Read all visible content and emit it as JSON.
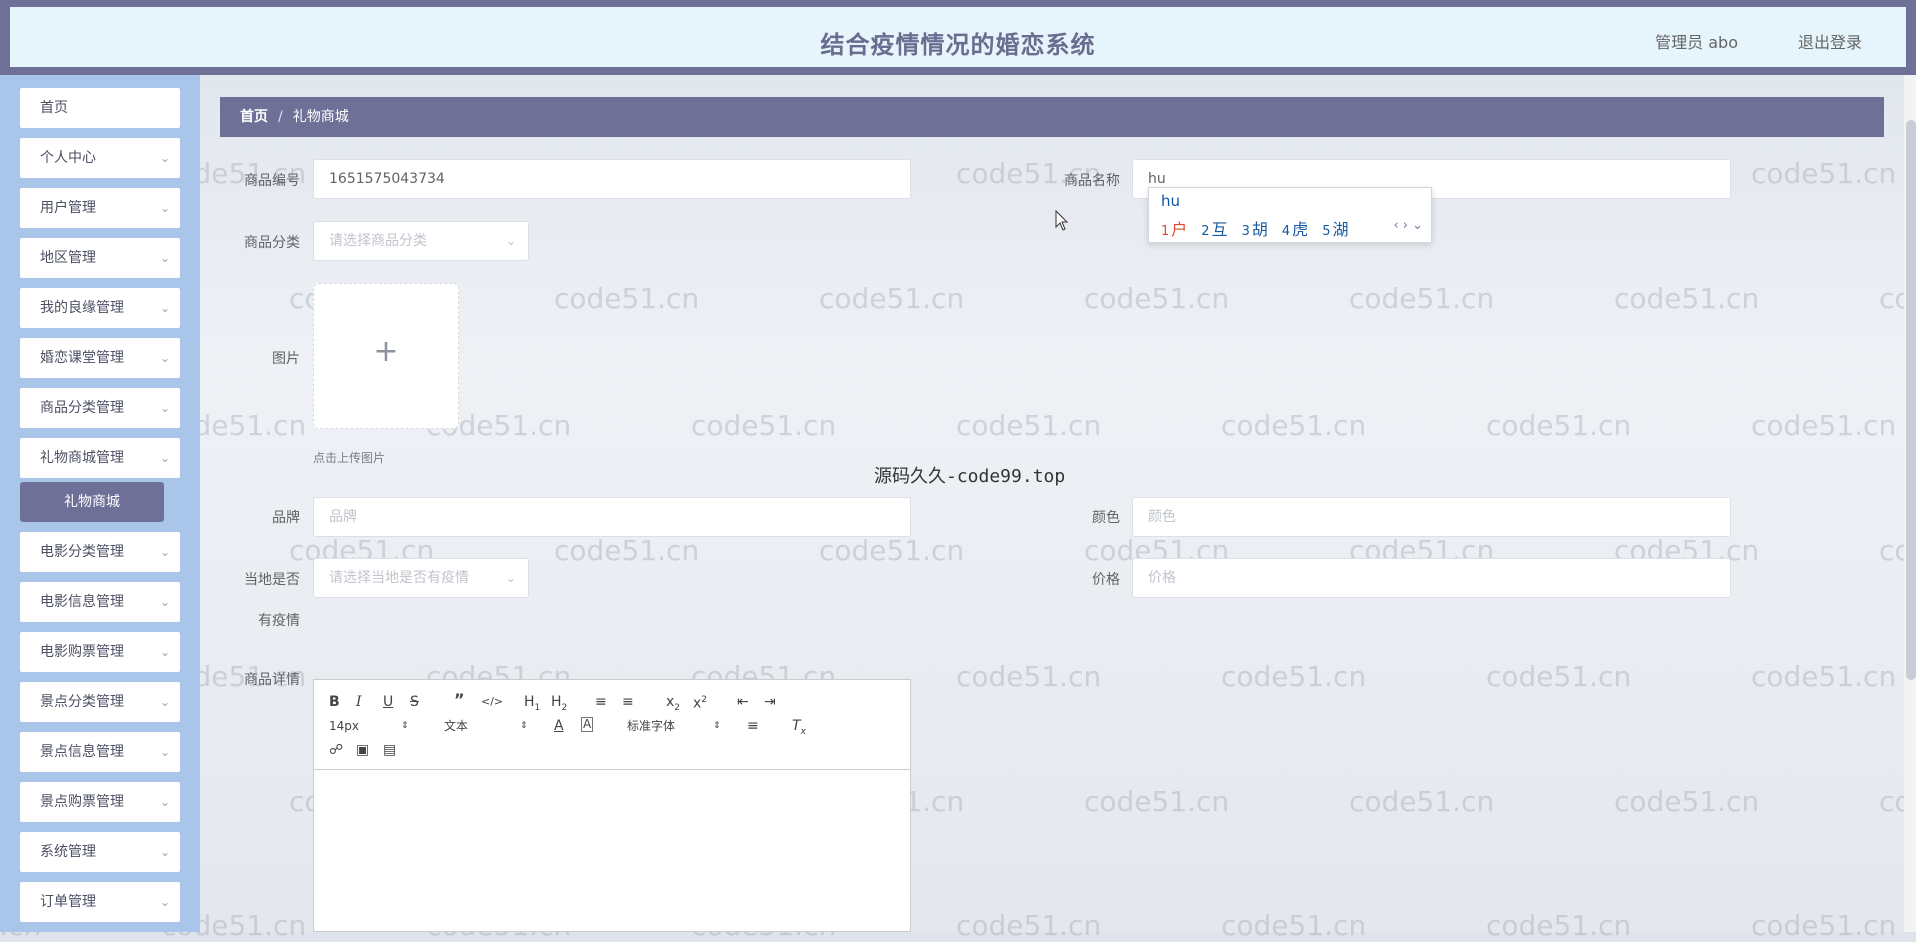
{
  "header": {
    "title": "结合疫情情况的婚恋系统",
    "user": "管理员 abo",
    "logout": "退出登录"
  },
  "sidebar": {
    "items": [
      {
        "label": "首页",
        "has_arrow": false
      },
      {
        "label": "个人中心",
        "has_arrow": true
      },
      {
        "label": "用户管理",
        "has_arrow": true
      },
      {
        "label": "地区管理",
        "has_arrow": true
      },
      {
        "label": "我的良缘管理",
        "has_arrow": true
      },
      {
        "label": "婚恋课堂管理",
        "has_arrow": true
      },
      {
        "label": "商品分类管理",
        "has_arrow": true
      },
      {
        "label": "礼物商城管理",
        "has_arrow": true
      },
      {
        "label": "电影分类管理",
        "has_arrow": true
      },
      {
        "label": "电影信息管理",
        "has_arrow": true
      },
      {
        "label": "电影购票管理",
        "has_arrow": true
      },
      {
        "label": "景点分类管理",
        "has_arrow": true
      },
      {
        "label": "景点信息管理",
        "has_arrow": true
      },
      {
        "label": "景点购票管理",
        "has_arrow": true
      },
      {
        "label": "系统管理",
        "has_arrow": true
      },
      {
        "label": "订单管理",
        "has_arrow": true
      }
    ],
    "active_sub": "礼物商城"
  },
  "breadcrumb": {
    "home": "首页",
    "separator": "/",
    "current": "礼物商城"
  },
  "form": {
    "code_label": "商品编号",
    "code_value": "1651575043734",
    "name_label": "商品名称",
    "name_value": "hu",
    "category_label": "商品分类",
    "category_placeholder": "请选择商品分类",
    "image_label": "图片",
    "upload_tip": "点击上传图片",
    "brand_label": "品牌",
    "brand_placeholder": "品牌",
    "color_label": "颜色",
    "color_placeholder": "颜色",
    "epidemic_label_1": "当地是否",
    "epidemic_label_2": "有疫情",
    "epidemic_placeholder": "请选择当地是否有疫情",
    "price_label": "价格",
    "price_placeholder": "价格",
    "detail_label": "商品详情"
  },
  "ime": {
    "pinyin": "hu",
    "candidates": [
      {
        "n": "1",
        "c": "户"
      },
      {
        "n": "2",
        "c": "互"
      },
      {
        "n": "3",
        "c": "胡"
      },
      {
        "n": "4",
        "c": "虎"
      },
      {
        "n": "5",
        "c": "湖"
      }
    ],
    "nav": "‹ › ⌄"
  },
  "editor": {
    "font_size": "14px",
    "block_format": "文本",
    "font_family": "标准字体"
  },
  "watermark": "code51.cn",
  "center_mark": "源码久久-code99.top",
  "colors": {
    "accent": "#6f7098",
    "sidebar_bg": "#a9c5ea",
    "header_bg": "#e6f4fb"
  }
}
